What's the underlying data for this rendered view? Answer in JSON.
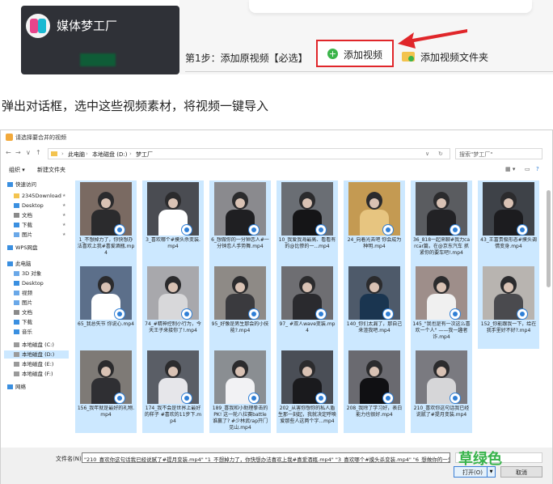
{
  "app": {
    "title": "媒体梦工厂"
  },
  "step": {
    "label": "第1步：添加原视频【必选】",
    "add_video_label": "添加视频",
    "add_folder_label": "添加视频文件夹"
  },
  "instruction": "弹出对话框，选中这些视频素材，将视频一键导入",
  "dialog": {
    "title": "请选择要合并的视频",
    "nav": {
      "back": "←",
      "forward": "→",
      "up_history": "∨",
      "up": "↑",
      "refresh": "↻",
      "dropdown": "∨"
    },
    "breadcrumbs": [
      "此电脑",
      "本地磁盘 (D:)",
      "梦工厂"
    ],
    "search_placeholder": "搜索\"梦工厂\"",
    "toolbar": {
      "organize": "组织 ▾",
      "new_folder": "新建文件夹"
    },
    "sidebar": [
      {
        "label": "快速访问",
        "icon": "star-icon",
        "pinned": false
      },
      {
        "label": "2345Download",
        "icon": "folder-icon",
        "pinned": true
      },
      {
        "label": "Desktop",
        "icon": "desktop-icon",
        "pinned": true
      },
      {
        "label": "文档",
        "icon": "document-icon",
        "pinned": true
      },
      {
        "label": "下载",
        "icon": "download-icon",
        "pinned": true
      },
      {
        "label": "图片",
        "icon": "picture-icon",
        "pinned": true
      },
      {
        "label": "WPS网盘",
        "icon": "cloud-icon",
        "pinned": false
      },
      {
        "label": "此电脑",
        "icon": "computer-icon",
        "pinned": false
      },
      {
        "label": "3D 对象",
        "icon": "cube-icon",
        "pinned": false
      },
      {
        "label": "Desktop",
        "icon": "desktop-icon",
        "pinned": false
      },
      {
        "label": "视频",
        "icon": "video-icon",
        "pinned": false
      },
      {
        "label": "图片",
        "icon": "picture-icon",
        "pinned": false
      },
      {
        "label": "文档",
        "icon": "document-icon",
        "pinned": false
      },
      {
        "label": "下载",
        "icon": "download-icon",
        "pinned": false
      },
      {
        "label": "音乐",
        "icon": "music-icon",
        "pinned": false
      },
      {
        "label": "本地磁盘 (C:)",
        "icon": "drive-icon",
        "pinned": false
      },
      {
        "label": "本地磁盘 (D:)",
        "icon": "drive-icon",
        "pinned": false,
        "selected": true
      },
      {
        "label": "本地磁盘 (E:)",
        "icon": "drive-icon",
        "pinned": false
      },
      {
        "label": "本地磁盘 (F:)",
        "icon": "drive-icon",
        "pinned": false
      },
      {
        "label": "网络",
        "icon": "network-icon",
        "pinned": false
      }
    ],
    "files": [
      "1_不想掉力了，你快想办法喜欢上我#喜爱酒瓶.mp4",
      "3_喜欢哪个#摸头杀变装.mp4",
      "6_想做你的一分钟恋人#一分钟恋人手势舞.mp4",
      "10_我爱我海最高、看看有的@比惨的一...mp4",
      "24_向着光去吧 你会成为种明.mp4",
      "36_818一起来聊#我力carcar篇，在@京东汽车 抓紧你的要车吧!.mp4",
      "43_王富贵极形态#摸头调情变身.mp4",
      "65_我总失节 你说心.mp4",
      "74_#精神控制小行为，今天王子来接你了!.mp4",
      "95_好像是男生那会的小技能?.mp4",
      "97_ #双人wave变装.mp4",
      "140_你们太漏了，那自己来渣我吧.mp4",
      "145_\"我也是有一次这么喜欢一个人\" ——我一趣者诈.mp4",
      "152_你能跟我一下，给在我手里好不好?.mp4",
      "156_我年就是最好的礼物.mp4",
      "174_我不会是世界上最好的样子 #喜欢的11步下.mp4",
      "189_喜我和小助理拳击的PK! 这一轮八拉赛battle 谁赢了? #少林武rap开门见山.mp4",
      "202_从害你想你的私人盾生那一刻起，我就决定呼唤爱那些人这两个字...mp4",
      "208_我除了学习好，表白能力也很好.mp4",
      "210_喜欢你这句话我已经说腻了#提月变装.mp4"
    ],
    "filename_label": "文件名(N):",
    "filename_value": "\"210_喜欢你这句话我已经说腻了#提月变装.mp4\" \"1_不想掉力了，你快想办法喜欢上我#喜爱酒瓶.mp4\" \"3_喜欢哪个#摸头杀变装.mp4\" \"6_想做你的一分钟",
    "watermark": "草绿色",
    "open_label": "打开(O)",
    "cancel_label": "取消"
  },
  "colors": {
    "selection": "#cce8ff",
    "highlight_border": "#e0262a",
    "accent_green": "#37b34a"
  }
}
